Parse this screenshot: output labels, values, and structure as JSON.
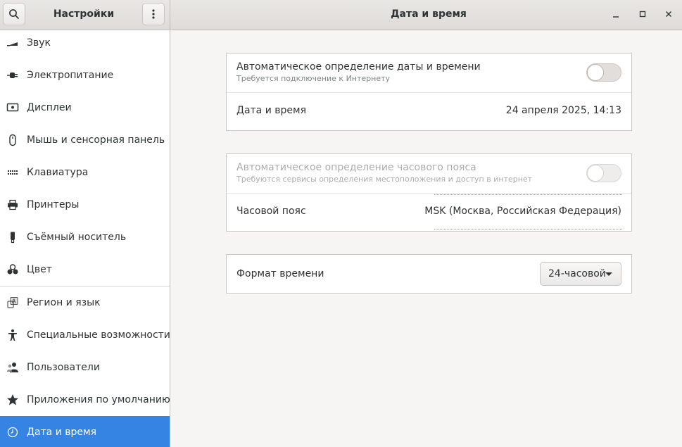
{
  "header": {
    "settings_title": "Настройки",
    "window_title": "Дата и время",
    "search_icon": "search-icon",
    "menu_icon": "view-more-icon"
  },
  "sidebar": {
    "items": [
      {
        "label": "Звук",
        "icon": "speaker-icon"
      },
      {
        "label": "Электропитание",
        "icon": "power-plug-icon"
      },
      {
        "label": "Дисплеи",
        "icon": "display-icon"
      },
      {
        "label": "Мышь и сенсорная панель",
        "icon": "mouse-icon"
      },
      {
        "label": "Клавиатура",
        "icon": "keyboard-icon"
      },
      {
        "label": "Принтеры",
        "icon": "printer-icon"
      },
      {
        "label": "Съёмный носитель",
        "icon": "removable-media-icon"
      },
      {
        "label": "Цвет",
        "icon": "color-icon"
      },
      {
        "label": "Регион и язык",
        "icon": "region-language-icon"
      },
      {
        "label": "Специальные возможности",
        "icon": "accessibility-icon"
      },
      {
        "label": "Пользователи",
        "icon": "users-icon"
      },
      {
        "label": "Приложения по умолчанию",
        "icon": "star-icon"
      },
      {
        "label": "Дата и время",
        "icon": "clock-icon",
        "active": true
      }
    ]
  },
  "datetime": {
    "auto_datetime_title": "Автоматическое определение даты и времени",
    "auto_datetime_subtitle": "Требуется подключение к Интернету",
    "auto_datetime_enabled": false,
    "datetime_label": "Дата и время",
    "datetime_value": "24 апреля 2025, 14:13"
  },
  "timezone": {
    "auto_tz_title": "Автоматическое определение часового пояса",
    "auto_tz_subtitle": "Требуются сервисы определения местоположения и доступ в интернет",
    "auto_tz_enabled": false,
    "tz_label": "Часовой пояс",
    "tz_value": "MSK (Москва, Российская Федерация)"
  },
  "time_format": {
    "label": "Формат времени",
    "selected": "24-часовой"
  },
  "colors": {
    "accent": "#3584e4",
    "sidebar_bg": "#ffffff",
    "content_bg": "#f6f5f4"
  }
}
